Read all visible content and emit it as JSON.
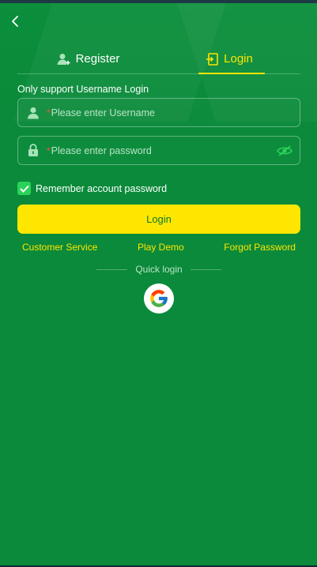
{
  "tabs": {
    "register": "Register",
    "login": "Login",
    "active": "login"
  },
  "hint": "Only support Username Login",
  "username": {
    "required_mark": "*",
    "placeholder": "Please enter Username",
    "value": ""
  },
  "password": {
    "required_mark": "*",
    "placeholder": "Please enter password",
    "value": ""
  },
  "remember": {
    "label": "Remember account password",
    "checked": true
  },
  "login_button": "Login",
  "links": {
    "customer_service": "Customer Service",
    "play_demo": "Play Demo",
    "forgot_password": "Forgot Password"
  },
  "quick_login": {
    "label": "Quick login",
    "providers": [
      "google-icon"
    ]
  },
  "colors": {
    "background": "#0a8a3a",
    "accent": "#ffe600",
    "checkbox": "#2ad25a",
    "required": "#ff4b4b"
  }
}
